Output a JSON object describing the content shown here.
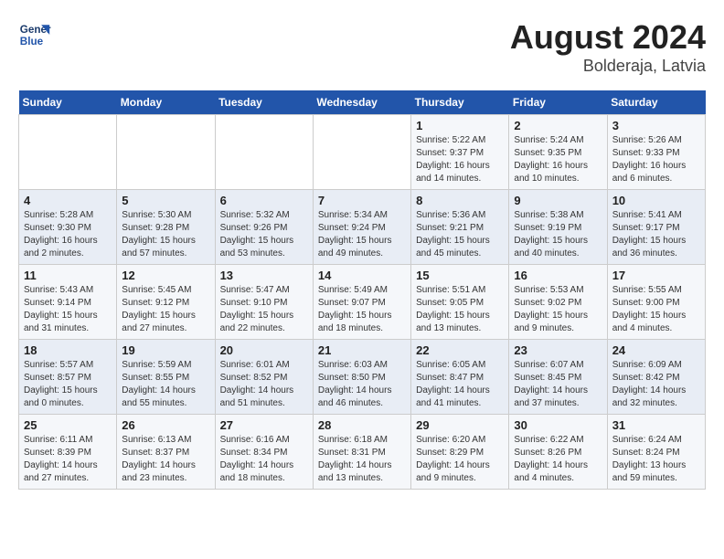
{
  "header": {
    "logo_line1": "General",
    "logo_line2": "Blue",
    "month": "August 2024",
    "location": "Bolderaja, Latvia"
  },
  "weekdays": [
    "Sunday",
    "Monday",
    "Tuesday",
    "Wednesday",
    "Thursday",
    "Friday",
    "Saturday"
  ],
  "weeks": [
    [
      {
        "day": "",
        "info": ""
      },
      {
        "day": "",
        "info": ""
      },
      {
        "day": "",
        "info": ""
      },
      {
        "day": "",
        "info": ""
      },
      {
        "day": "1",
        "info": "Sunrise: 5:22 AM\nSunset: 9:37 PM\nDaylight: 16 hours\nand 14 minutes."
      },
      {
        "day": "2",
        "info": "Sunrise: 5:24 AM\nSunset: 9:35 PM\nDaylight: 16 hours\nand 10 minutes."
      },
      {
        "day": "3",
        "info": "Sunrise: 5:26 AM\nSunset: 9:33 PM\nDaylight: 16 hours\nand 6 minutes."
      }
    ],
    [
      {
        "day": "4",
        "info": "Sunrise: 5:28 AM\nSunset: 9:30 PM\nDaylight: 16 hours\nand 2 minutes."
      },
      {
        "day": "5",
        "info": "Sunrise: 5:30 AM\nSunset: 9:28 PM\nDaylight: 15 hours\nand 57 minutes."
      },
      {
        "day": "6",
        "info": "Sunrise: 5:32 AM\nSunset: 9:26 PM\nDaylight: 15 hours\nand 53 minutes."
      },
      {
        "day": "7",
        "info": "Sunrise: 5:34 AM\nSunset: 9:24 PM\nDaylight: 15 hours\nand 49 minutes."
      },
      {
        "day": "8",
        "info": "Sunrise: 5:36 AM\nSunset: 9:21 PM\nDaylight: 15 hours\nand 45 minutes."
      },
      {
        "day": "9",
        "info": "Sunrise: 5:38 AM\nSunset: 9:19 PM\nDaylight: 15 hours\nand 40 minutes."
      },
      {
        "day": "10",
        "info": "Sunrise: 5:41 AM\nSunset: 9:17 PM\nDaylight: 15 hours\nand 36 minutes."
      }
    ],
    [
      {
        "day": "11",
        "info": "Sunrise: 5:43 AM\nSunset: 9:14 PM\nDaylight: 15 hours\nand 31 minutes."
      },
      {
        "day": "12",
        "info": "Sunrise: 5:45 AM\nSunset: 9:12 PM\nDaylight: 15 hours\nand 27 minutes."
      },
      {
        "day": "13",
        "info": "Sunrise: 5:47 AM\nSunset: 9:10 PM\nDaylight: 15 hours\nand 22 minutes."
      },
      {
        "day": "14",
        "info": "Sunrise: 5:49 AM\nSunset: 9:07 PM\nDaylight: 15 hours\nand 18 minutes."
      },
      {
        "day": "15",
        "info": "Sunrise: 5:51 AM\nSunset: 9:05 PM\nDaylight: 15 hours\nand 13 minutes."
      },
      {
        "day": "16",
        "info": "Sunrise: 5:53 AM\nSunset: 9:02 PM\nDaylight: 15 hours\nand 9 minutes."
      },
      {
        "day": "17",
        "info": "Sunrise: 5:55 AM\nSunset: 9:00 PM\nDaylight: 15 hours\nand 4 minutes."
      }
    ],
    [
      {
        "day": "18",
        "info": "Sunrise: 5:57 AM\nSunset: 8:57 PM\nDaylight: 15 hours\nand 0 minutes."
      },
      {
        "day": "19",
        "info": "Sunrise: 5:59 AM\nSunset: 8:55 PM\nDaylight: 14 hours\nand 55 minutes."
      },
      {
        "day": "20",
        "info": "Sunrise: 6:01 AM\nSunset: 8:52 PM\nDaylight: 14 hours\nand 51 minutes."
      },
      {
        "day": "21",
        "info": "Sunrise: 6:03 AM\nSunset: 8:50 PM\nDaylight: 14 hours\nand 46 minutes."
      },
      {
        "day": "22",
        "info": "Sunrise: 6:05 AM\nSunset: 8:47 PM\nDaylight: 14 hours\nand 41 minutes."
      },
      {
        "day": "23",
        "info": "Sunrise: 6:07 AM\nSunset: 8:45 PM\nDaylight: 14 hours\nand 37 minutes."
      },
      {
        "day": "24",
        "info": "Sunrise: 6:09 AM\nSunset: 8:42 PM\nDaylight: 14 hours\nand 32 minutes."
      }
    ],
    [
      {
        "day": "25",
        "info": "Sunrise: 6:11 AM\nSunset: 8:39 PM\nDaylight: 14 hours\nand 27 minutes."
      },
      {
        "day": "26",
        "info": "Sunrise: 6:13 AM\nSunset: 8:37 PM\nDaylight: 14 hours\nand 23 minutes."
      },
      {
        "day": "27",
        "info": "Sunrise: 6:16 AM\nSunset: 8:34 PM\nDaylight: 14 hours\nand 18 minutes."
      },
      {
        "day": "28",
        "info": "Sunrise: 6:18 AM\nSunset: 8:31 PM\nDaylight: 14 hours\nand 13 minutes."
      },
      {
        "day": "29",
        "info": "Sunrise: 6:20 AM\nSunset: 8:29 PM\nDaylight: 14 hours\nand 9 minutes."
      },
      {
        "day": "30",
        "info": "Sunrise: 6:22 AM\nSunset: 8:26 PM\nDaylight: 14 hours\nand 4 minutes."
      },
      {
        "day": "31",
        "info": "Sunrise: 6:24 AM\nSunset: 8:24 PM\nDaylight: 13 hours\nand 59 minutes."
      }
    ]
  ]
}
